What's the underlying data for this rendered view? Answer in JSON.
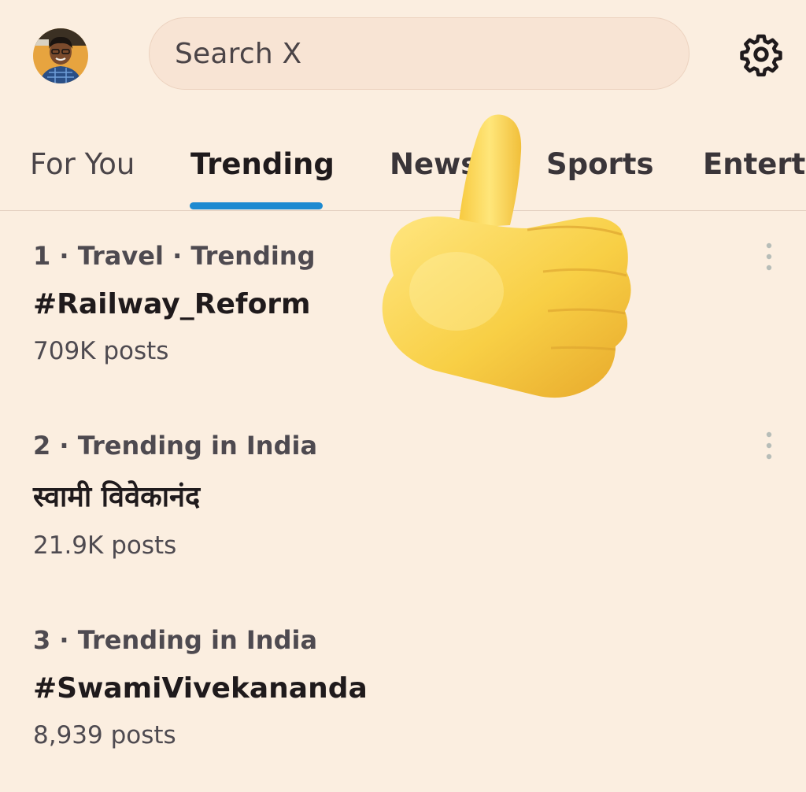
{
  "header": {
    "avatar_icon": "user-avatar",
    "search": {
      "placeholder": "Search X"
    },
    "settings_icon": "gear-icon"
  },
  "tabs": [
    {
      "label": "For You",
      "active": false
    },
    {
      "label": "Trending",
      "active": true
    },
    {
      "label": "News",
      "active": false
    },
    {
      "label": "Sports",
      "active": false
    },
    {
      "label": "Enterta",
      "active": false
    }
  ],
  "accent_color": "#1d8ad1",
  "background_color": "#fbeee0",
  "trends": [
    {
      "meta": "1 · Travel · Trending",
      "title": "#Railway_Reform",
      "posts": "709K posts"
    },
    {
      "meta": "2 · Trending in India",
      "title": "स्वामी विवेकानंद",
      "posts": "21.9K posts"
    },
    {
      "meta": "3 · Trending in India",
      "title": "#SwamiVivekananda",
      "posts": "8,939 posts"
    }
  ],
  "overlay_icon": "thumbs-up-emoji"
}
